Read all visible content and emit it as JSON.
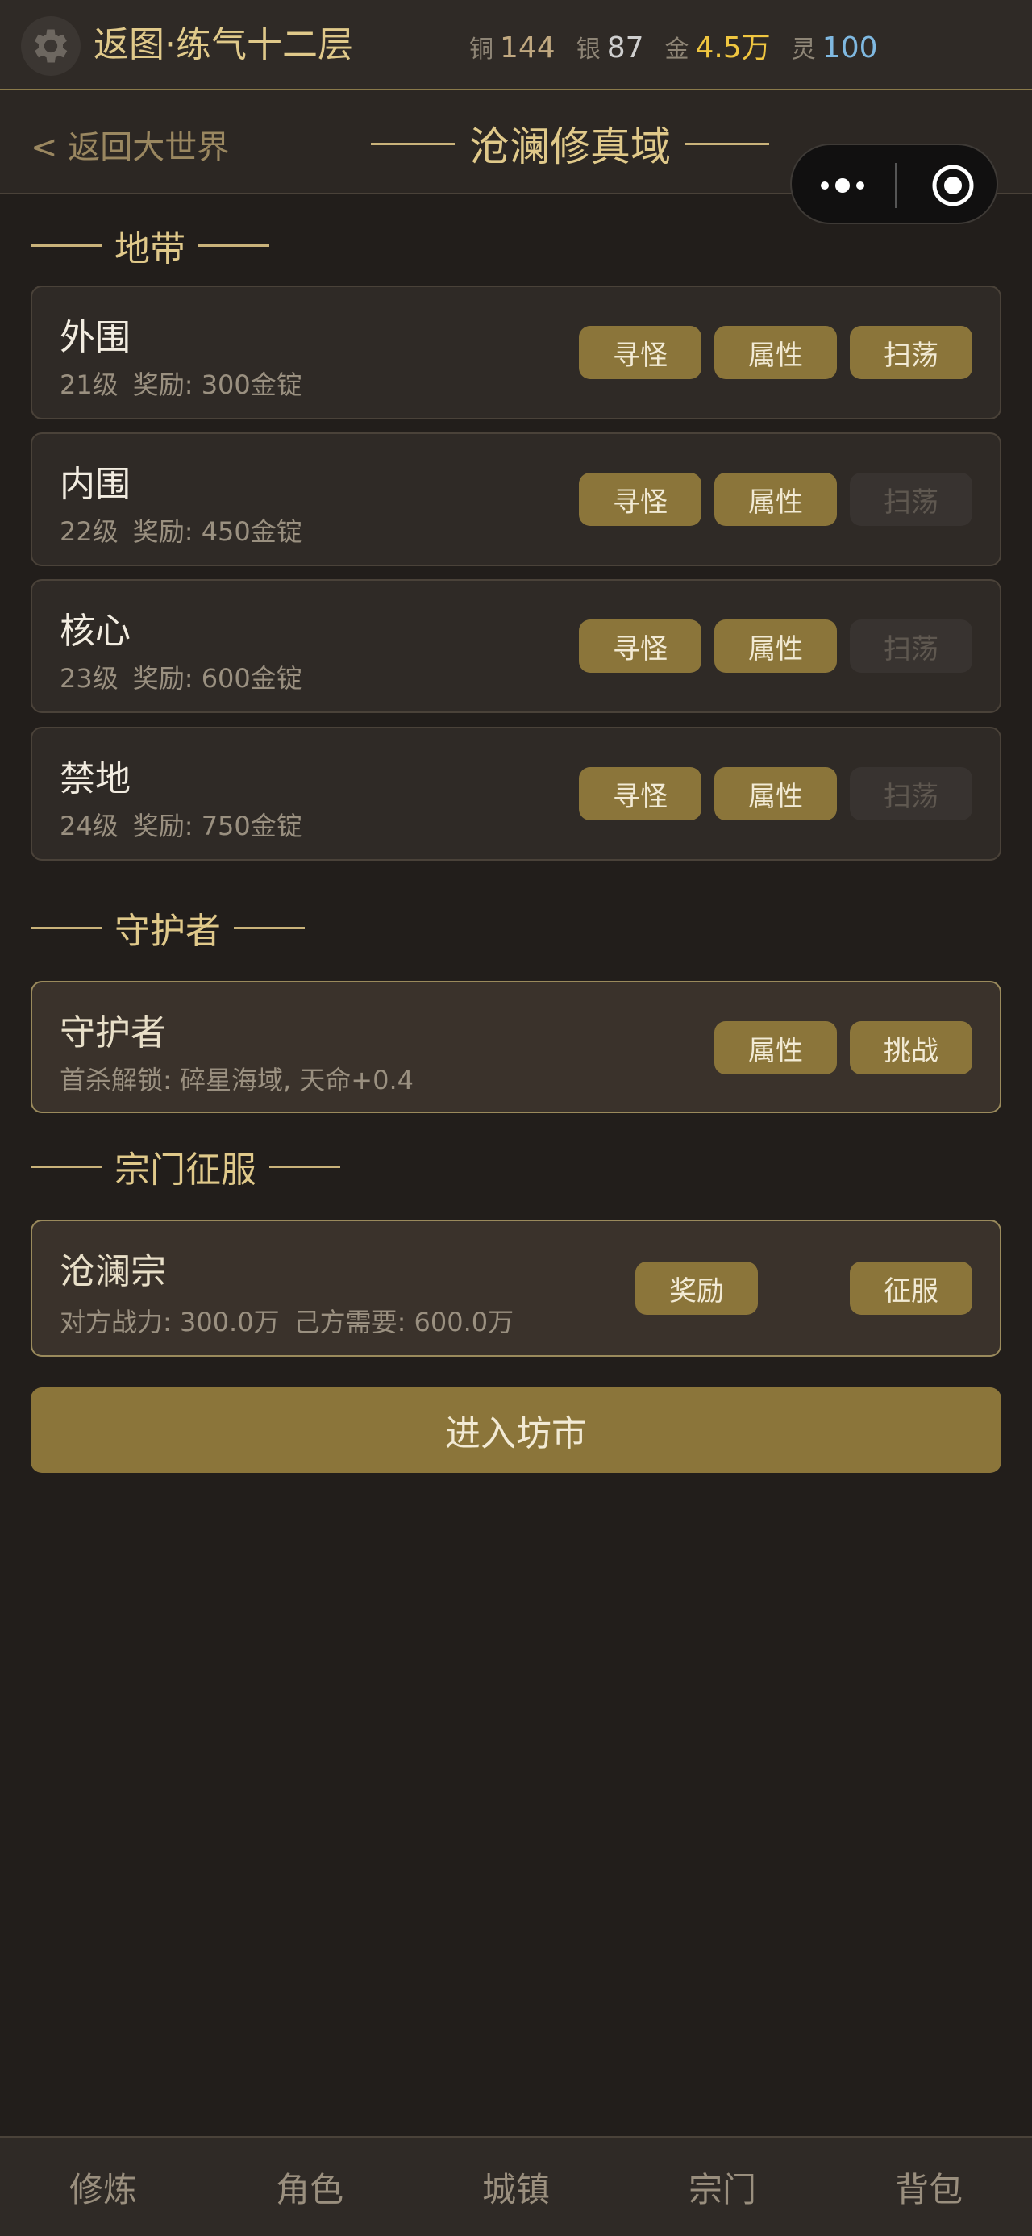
{
  "header": {
    "player_name": "返图·练气十二层",
    "currencies": [
      {
        "label": "铜",
        "value": "144",
        "color": "#c0a880"
      },
      {
        "label": "银",
        "value": "87",
        "color": "#cfcfcf"
      },
      {
        "label": "金",
        "value": "4.5万",
        "color": "#f0c640"
      },
      {
        "label": "灵",
        "value": "100",
        "color": "#7fb8e0"
      }
    ]
  },
  "titlebar": {
    "back_label": "< 返回大世界",
    "region_title": "沧澜修真域"
  },
  "sections": {
    "zones_title": "地带",
    "guardian_title": "守护者",
    "conquest_title": "宗门征服"
  },
  "zones": [
    {
      "name": "外围",
      "level": "21级",
      "reward": "奖励: 300金锭",
      "btn_hunt": "寻怪",
      "btn_attr": "属性",
      "btn_sweep": "扫荡",
      "sweep_enabled": true
    },
    {
      "name": "内围",
      "level": "22级",
      "reward": "奖励: 450金锭",
      "btn_hunt": "寻怪",
      "btn_attr": "属性",
      "btn_sweep": "扫荡",
      "sweep_enabled": false
    },
    {
      "name": "核心",
      "level": "23级",
      "reward": "奖励: 600金锭",
      "btn_hunt": "寻怪",
      "btn_attr": "属性",
      "btn_sweep": "扫荡",
      "sweep_enabled": false
    },
    {
      "name": "禁地",
      "level": "24级",
      "reward": "奖励: 750金锭",
      "btn_hunt": "寻怪",
      "btn_attr": "属性",
      "btn_sweep": "扫荡",
      "sweep_enabled": false
    }
  ],
  "guardian": {
    "name": "守护者",
    "info": "首杀解锁: 碎星海域, 天命+0.4",
    "btn_attr": "属性",
    "btn_challenge": "挑战"
  },
  "conquest": {
    "name": "沧澜宗",
    "enemy_power": "对方战力: 300.0万",
    "required_power": "己方需要: 600.0万",
    "btn_reward": "奖励",
    "btn_conquer": "征服"
  },
  "market_button": "进入坊市",
  "bottom_nav": [
    "修炼",
    "角色",
    "城镇",
    "宗门",
    "背包"
  ],
  "colors": {
    "accent_gold": "#e0c98a",
    "button_bg": "#8b753a",
    "background": "#221e1b"
  }
}
